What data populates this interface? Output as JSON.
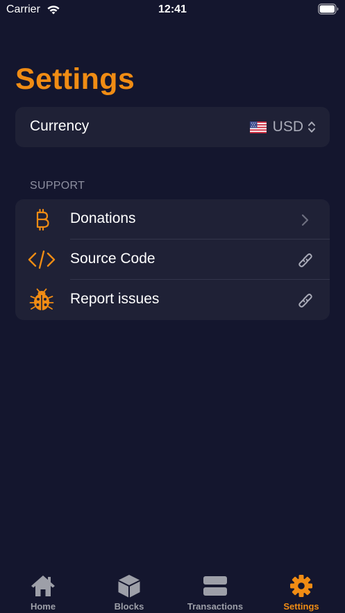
{
  "status_bar": {
    "carrier": "Carrier",
    "time": "12:41"
  },
  "page": {
    "title": "Settings"
  },
  "currency": {
    "label": "Currency",
    "flag": "🇺🇸",
    "value": "USD"
  },
  "support": {
    "header": "SUPPORT",
    "items": [
      {
        "label": "Donations",
        "icon": "bitcoin-icon",
        "accessory": "chevron-right-icon"
      },
      {
        "label": "Source Code",
        "icon": "code-icon",
        "accessory": "link-icon"
      },
      {
        "label": "Report issues",
        "icon": "ladybug-icon",
        "accessory": "link-icon"
      }
    ]
  },
  "tab_bar": {
    "tabs": [
      {
        "label": "Home",
        "icon": "house-icon",
        "active": false
      },
      {
        "label": "Blocks",
        "icon": "cube-icon",
        "active": false
      },
      {
        "label": "Transactions",
        "icon": "list-rows-icon",
        "active": false
      },
      {
        "label": "Settings",
        "icon": "gear-icon",
        "active": true
      }
    ]
  },
  "colors": {
    "background": "#14162e",
    "card": "#1f2136",
    "accent": "#f08c14",
    "inactive_tab": "#9d9fa8",
    "secondary_text": "#a9abb8"
  }
}
